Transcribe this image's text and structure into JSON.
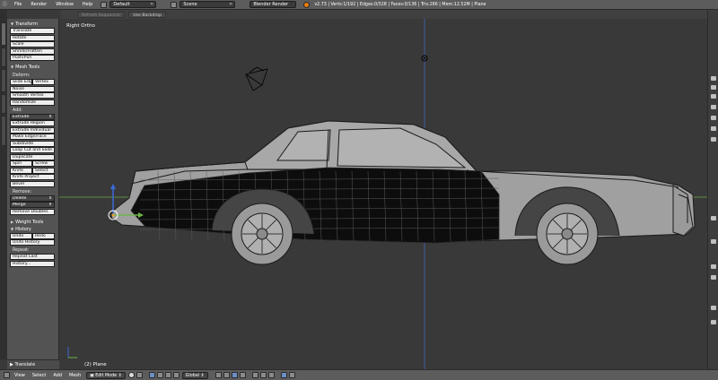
{
  "header": {
    "menus": [
      "File",
      "Render",
      "Window",
      "Help"
    ],
    "layout": "Default",
    "scene": "Scene",
    "render_engine": "Blender Render",
    "stats": "v2.73 | Verts:1/192 | Edges:0/328 | Faces:0/136 | Tris:266 | Mem:12.52M | Plane"
  },
  "secondbar": {
    "refresh_label": "Refresh Sequencer",
    "backdrop_label": "Use Backdrop"
  },
  "toolshelf": {
    "transform": {
      "title": "Transform",
      "buttons": [
        "Translate",
        "Rotate",
        "Scale",
        "Shrink/Flatten",
        "Push/Pull"
      ]
    },
    "mesh_tools": {
      "title": "Mesh Tools",
      "deform_label": "Deform:",
      "slide_edge": "Slide Edg",
      "vertex": "Vertex",
      "deform_buttons": [
        "Noise",
        "Smooth Vertex",
        "Randomize"
      ],
      "add_label": "Add:",
      "extrude_dropdown": "Extrude",
      "add_buttons": [
        "Extrude Region",
        "Extrude Individual",
        "Make Edge/Face",
        "Subdivide",
        "Loop Cut and Slide",
        "Duplicate"
      ],
      "spin": "Spin",
      "screw": "Screw",
      "knife": "Knife",
      "select": "Select",
      "knife_project": "Knife Project",
      "bevel": "Bevel",
      "remove_label": "Remove:",
      "delete_dropdown": "Delete",
      "merge_dropdown": "Merge",
      "remove_doubles": "Remove Doubles"
    },
    "weight_tools": {
      "title": "Weight Tools"
    },
    "history": {
      "title": "History",
      "undo": "Undo",
      "redo": "Redo",
      "undo_history": "Undo History",
      "repeat_label": "Repeat:",
      "repeat_last": "Repeat Last",
      "history_btn": "History..."
    },
    "operator_panel": "Translate"
  },
  "viewport": {
    "view_label": "Right Ortho",
    "object_label": "(2) Plane"
  },
  "footer": {
    "menus": [
      "View",
      "Select",
      "Add",
      "Mesh"
    ],
    "mode": "Edit Mode",
    "orientation": "Global"
  },
  "colors": {
    "accent": "#6b8fc4",
    "y_axis": "#6fb34a",
    "z_axis": "#3a6cd6"
  }
}
